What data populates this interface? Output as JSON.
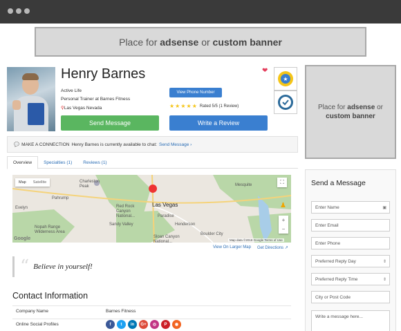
{
  "banner_top": {
    "prefix": "Place for ",
    "bold1": "adsense",
    "mid": " or ",
    "bold2": "custom banner"
  },
  "profile": {
    "name": "Henry Barnes",
    "line1": "Active Life",
    "line2": "Personal Trainer at Barnes Fitness",
    "location": "Las Vegas Nevada",
    "phone_button": "View Phone Number",
    "rating_text": "Rated 5/5 (1 Review)",
    "rating_stars": 5,
    "send_message_button": "Send Message",
    "write_review_button": "Write a Review"
  },
  "banner_side": {
    "prefix": "Place for ",
    "bold1": "adsense",
    "mid": " or ",
    "bold2": "custom banner"
  },
  "connection": {
    "label": "MAKE A CONNECTION",
    "text": "Henry Barnes is currently available to chat:",
    "link": "Send Message ›"
  },
  "tabs": [
    {
      "label": "Overview"
    },
    {
      "label": "Specialties (1)"
    },
    {
      "label": "Reviews (1)"
    }
  ],
  "map": {
    "btn_map": "Map",
    "btn_satellite": "Satellite",
    "city": "Las Vegas",
    "labels": {
      "charleston": "Charleston Peak",
      "pahrump": "Pahrump",
      "red_rock": "Red Rock Canyon National...",
      "paradise": "Paradise",
      "henderson": "Henderson",
      "boulder": "Boulder City",
      "nopah": "Nopah Range Wilderness Area",
      "sloan": "Sloan Canyon National...",
      "evelyn": "Evelyn",
      "sandy": "Sandy Valley",
      "mesquite": "Mesquite"
    },
    "attribution": "Map data ©2018 Google   Terms of Use",
    "google": "Google",
    "larger_link": "View On Larger Map",
    "directions_link": "Get Directions"
  },
  "quote": "Believe in yourself!",
  "contact": {
    "title": "Contact Information",
    "company_label": "Company Name",
    "company_value": "Barnes Fitness",
    "social_label": "Online Social Profiles",
    "social": [
      {
        "name": "facebook",
        "glyph": "f",
        "color": "#3b5998"
      },
      {
        "name": "twitter",
        "glyph": "t",
        "color": "#1da1f2"
      },
      {
        "name": "linkedin",
        "glyph": "in",
        "color": "#0077b5"
      },
      {
        "name": "google-plus",
        "glyph": "G+",
        "color": "#dd4b39"
      },
      {
        "name": "instagram",
        "glyph": "◎",
        "color": "#c13584"
      },
      {
        "name": "pinterest",
        "glyph": "P",
        "color": "#cb2027"
      },
      {
        "name": "rss",
        "glyph": "◉",
        "color": "#f26522"
      }
    ]
  },
  "send_message": {
    "title": "Send a Message",
    "name_placeholder": "Enter Name",
    "email_placeholder": "Enter Email",
    "phone_placeholder": "Enter Phone",
    "reply_day": "Preferred Reply Day",
    "reply_time": "Preferred Reply Time",
    "city_placeholder": "City or Post Code",
    "message_placeholder": "Write a message here..."
  },
  "colors": {
    "accent_blue": "#3a7fd0",
    "accent_green": "#5ab660",
    "link": "#2a6db5",
    "heart": "#e43d5c"
  }
}
